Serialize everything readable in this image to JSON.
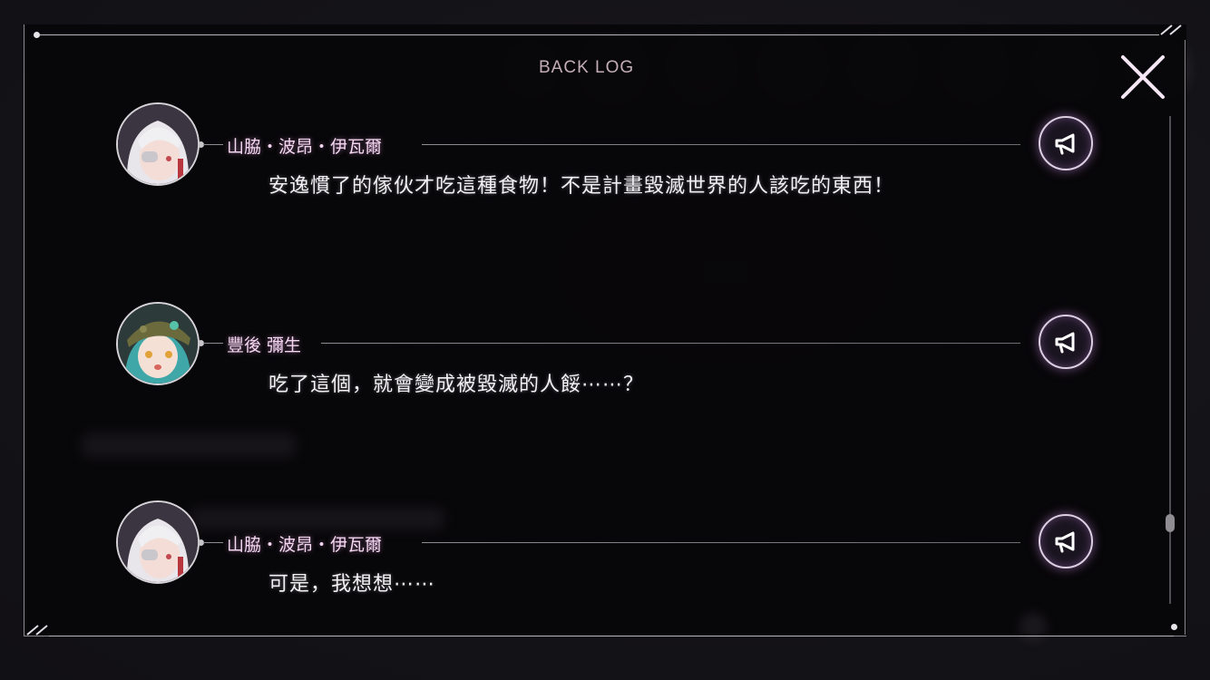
{
  "backlog": {
    "title": "BACK LOG"
  },
  "colors": {
    "accent_pink": "#f4d6f0",
    "panel_bg": "#060508",
    "frame": "#b9b6bc"
  },
  "icons": {
    "close": "close-x-icon",
    "voice": "megaphone-icon"
  },
  "entries": [
    {
      "speaker": "山脇・波昂・伊瓦爾",
      "text": "安逸慣了的傢伙才吃這種食物！不是計畫毀滅世界的人該吃的東西！"
    },
    {
      "speaker": "豐後 彌生",
      "text": "吃了這個，就會變成被毀滅的人餒⋯⋯？"
    },
    {
      "speaker": "山脇・波昂・伊瓦爾",
      "text": "可是，我想想⋯⋯"
    }
  ]
}
